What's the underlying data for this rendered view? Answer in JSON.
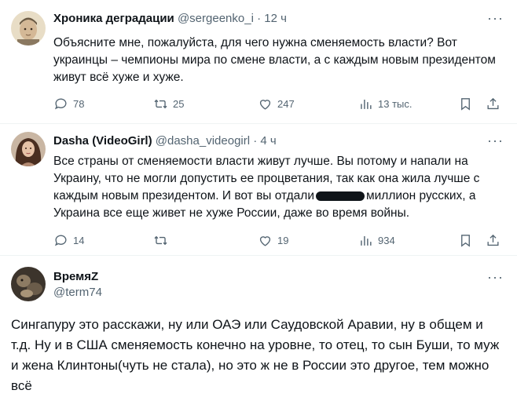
{
  "tweets": [
    {
      "display_name": "Хроника деградации",
      "handle": "@sergeenko_i",
      "dot": "·",
      "time": "12 ч",
      "more": "···",
      "text": "Объясните мне, пожалуйста, для чего нужна сменяемость власти? Вот украинцы – чемпионы мира по смене власти, а с каждым новым президентом живут всё хуже и хуже.",
      "replies": "78",
      "retweets": "25",
      "likes": "247",
      "views": "13 тыс.",
      "avatar_icon": "illustrated-portrait-avatar"
    },
    {
      "display_name": "Dasha (VideoGirl)",
      "handle": "@dasha_videogirl",
      "dot": "·",
      "time": "4 ч",
      "more": "···",
      "text_part1": "Все страны от сменяемости власти живут лучше. Вы потому и напали на Украину, что не могли допустить ее процветания, так как она жила лучше с каждым новым президентом. И вот вы отдали",
      "text_part2": "миллион русских, а Украина все еще живет не хуже России, даже во время войны.",
      "replies": "14",
      "retweets": "",
      "likes": "19",
      "views": "934",
      "avatar_icon": "woman-photo-avatar"
    },
    {
      "display_name": "ВремяZ",
      "handle": "@term74",
      "more": "···",
      "text": "Сингапуру это расскажи, ну или ОАЭ или Саудовской Аравии, ну в общем и т.д. Ну и в США сменяемость конечно на уровне, то отец, то сын Буши, то муж и жена Клинтоны(чуть не стала), но это ж не в России это другое, тем можно всё",
      "avatar_icon": "dark-photo-avatar"
    }
  ],
  "colors": {
    "text": "#0f1419",
    "secondary": "#536471",
    "divider": "#eff3f4"
  }
}
